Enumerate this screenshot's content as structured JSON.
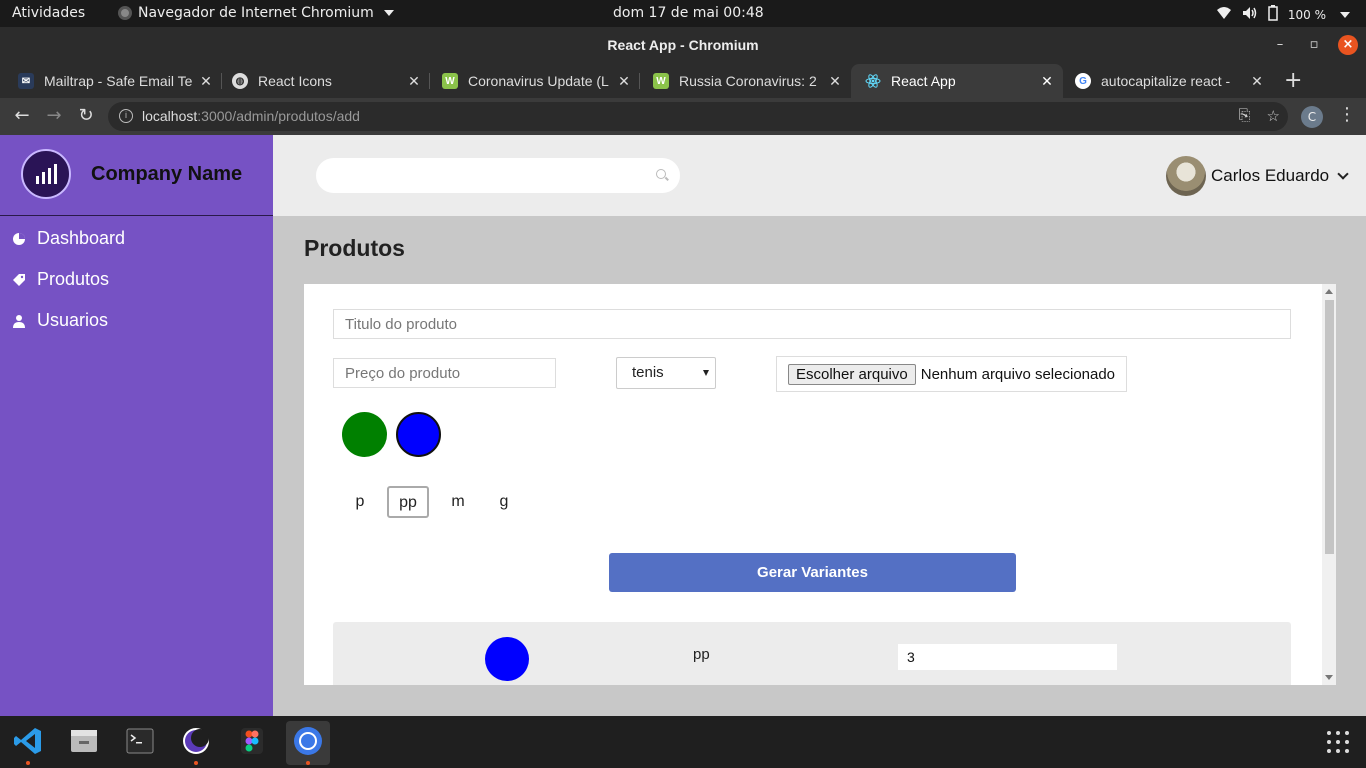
{
  "system_bar": {
    "activities": "Atividades",
    "app_menu": "Navegador de Internet Chromium",
    "clock": "dom 17 de mai  00:48",
    "battery": "100 %"
  },
  "window": {
    "title": "React App - Chromium"
  },
  "tabs": [
    {
      "label": "Mailtrap - Safe Email Te",
      "favicon": "mailtrap-icon"
    },
    {
      "label": "React Icons",
      "favicon": "globe-icon"
    },
    {
      "label": "Coronavirus Update (L",
      "favicon": "worldometer-icon"
    },
    {
      "label": "Russia Coronavirus: 2",
      "favicon": "worldometer-icon"
    },
    {
      "label": "React App",
      "favicon": "react-icon",
      "active": true
    },
    {
      "label": "autocapitalize react - ",
      "favicon": "google-icon"
    }
  ],
  "address_bar": {
    "url_host": "localhost",
    "url_rest": ":3000/admin/produtos/add",
    "profile_initial": "C"
  },
  "sidebar": {
    "company_name": "Company Name",
    "items": [
      {
        "label": "Dashboard",
        "icon": "pie-chart-icon"
      },
      {
        "label": "Produtos",
        "icon": "tag-icon"
      },
      {
        "label": "Usuarios",
        "icon": "user-icon"
      }
    ]
  },
  "header": {
    "search_placeholder": "",
    "user_name": "Carlos Eduardo"
  },
  "page": {
    "title": "Produtos"
  },
  "form": {
    "title_placeholder": "Titulo do produto",
    "price_placeholder": "Preço do produto",
    "category_selected": "tenis",
    "file_button": "Escolher arquivo",
    "file_status": "Nenhum arquivo selecionado",
    "colors": [
      {
        "hex": "#008000",
        "selected": false
      },
      {
        "hex": "#0000ff",
        "selected": true
      }
    ],
    "sizes": [
      {
        "label": "p",
        "selected": false
      },
      {
        "label": "pp",
        "selected": true
      },
      {
        "label": "m",
        "selected": false
      },
      {
        "label": "g",
        "selected": false
      }
    ],
    "generate_button": "Gerar Variantes"
  },
  "variants": [
    {
      "color": "#0000ff",
      "size": "pp",
      "quantity": "3"
    }
  ],
  "colors": {
    "sidebar_bg": "#7652c4",
    "primary_button": "#5470c4",
    "header_bg": "#ececec"
  }
}
